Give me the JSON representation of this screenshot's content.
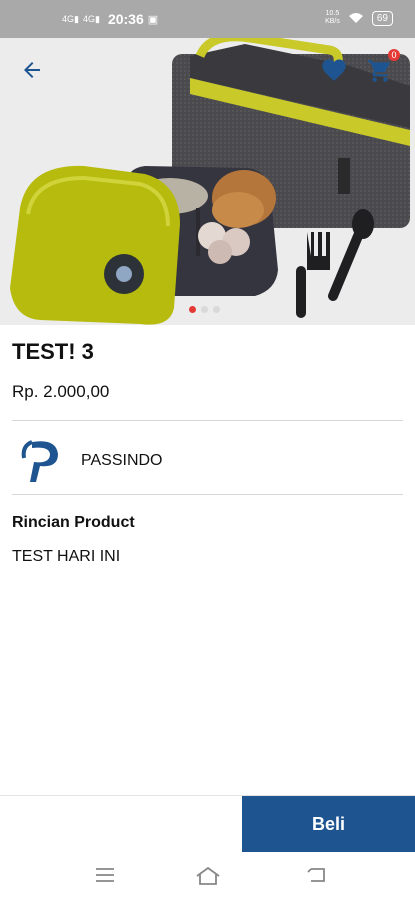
{
  "status_bar": {
    "signal_1": "4G",
    "signal_2": "4G",
    "time": "20:36",
    "net_speed_value": "10.5",
    "net_speed_unit": "KB/s",
    "battery": "69"
  },
  "header": {
    "back_icon": "arrow-left-icon",
    "favorite_icon": "heart-icon",
    "cart_icon": "shopping-cart-icon",
    "cart_count": "0"
  },
  "carousel": {
    "slide_count": 3,
    "active_index": 0
  },
  "product": {
    "title": "TEST! 3",
    "price": "Rp. 2.000,00"
  },
  "seller": {
    "name": "PASSINDO"
  },
  "details": {
    "heading": "Rincian Product",
    "text": "TEST HARI INI"
  },
  "actions": {
    "buy_label": "Beli"
  },
  "colors": {
    "brand": "#1e5591",
    "accent": "#e53935"
  }
}
